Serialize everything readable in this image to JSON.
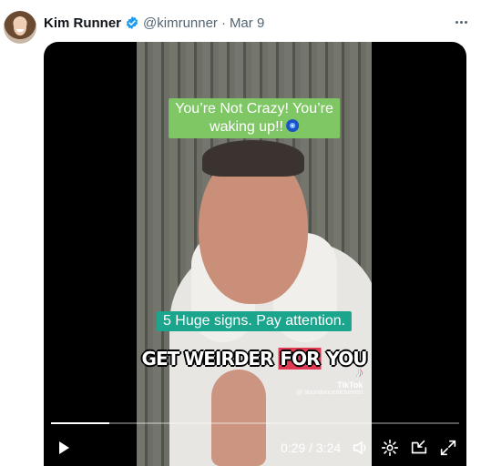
{
  "post": {
    "display_name": "Kim Runner",
    "handle": "@kimrunner",
    "separator": "·",
    "date": "Mar 9",
    "verified_color": "#1d9bf0"
  },
  "video": {
    "caption_top_line1": "You’re Not Crazy! You’re",
    "caption_top_line2": "waking up!!",
    "caption_middle": "5 Huge signs. Pay attention.",
    "caption_big_prefix": "GET WEIRDER ",
    "caption_big_highlight": "FOR",
    "caption_big_suffix": " YOU",
    "watermark_brand": "TikTok",
    "watermark_user": "@ abundancealchemist",
    "current_time": "0:29",
    "time_separator": " / ",
    "duration": "3:24",
    "progress_fraction": 0.142
  },
  "icons": {
    "more": "more-horizontal-icon",
    "play": "play-icon",
    "volume": "volume-icon",
    "settings": "settings-icon",
    "pip": "picture-in-picture-icon",
    "fullscreen": "fullscreen-icon"
  },
  "colors": {
    "caption_top_bg": "#7ec764",
    "caption_middle_bg": "#1aa58c",
    "highlight_bg": "#e23a54"
  }
}
